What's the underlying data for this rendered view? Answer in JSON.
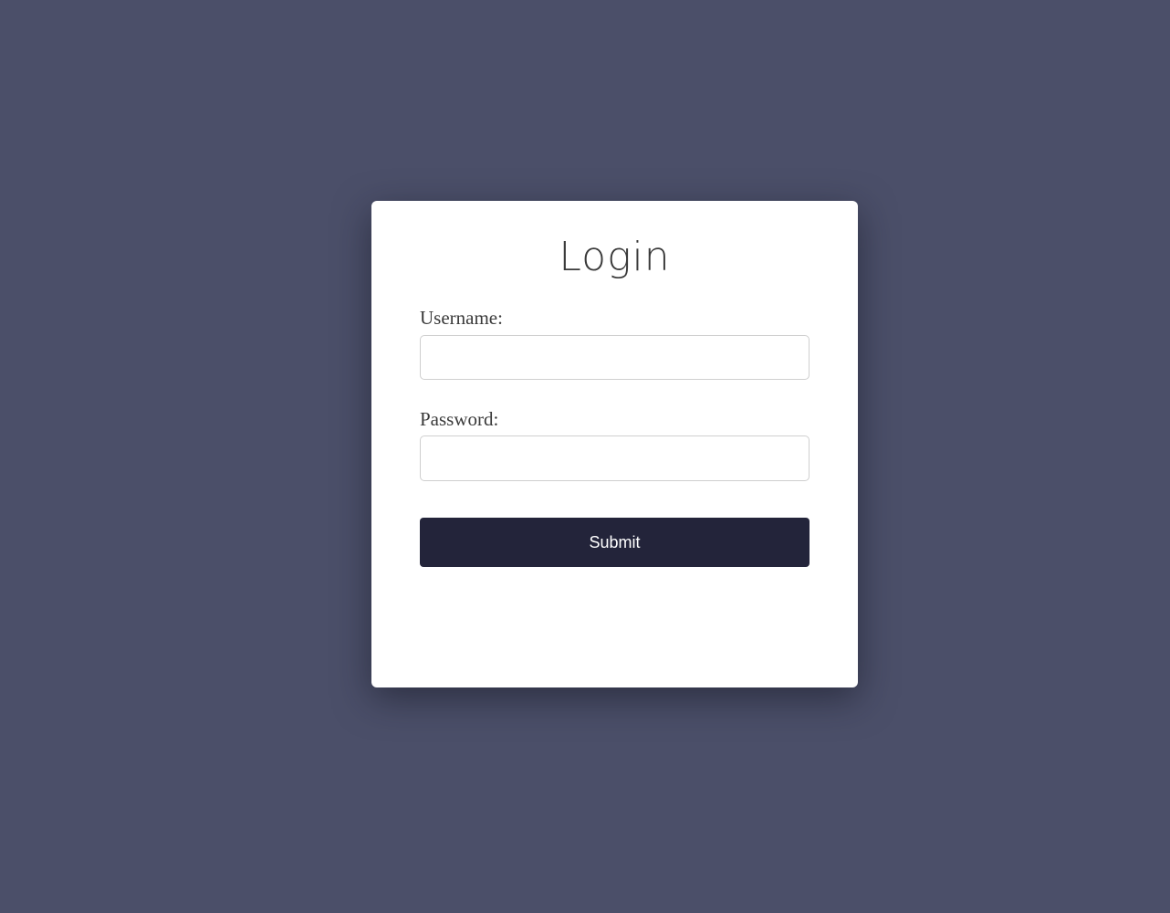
{
  "form": {
    "title": "Login",
    "username_label": "Username:",
    "username_value": "",
    "password_label": "Password:",
    "password_value": "",
    "submit_label": "Submit"
  },
  "colors": {
    "background": "#4b4f69",
    "card": "#ffffff",
    "button": "#23243a",
    "button_text": "#ffffff",
    "text": "#3a3a3a",
    "input_border": "#cfcfcf"
  }
}
